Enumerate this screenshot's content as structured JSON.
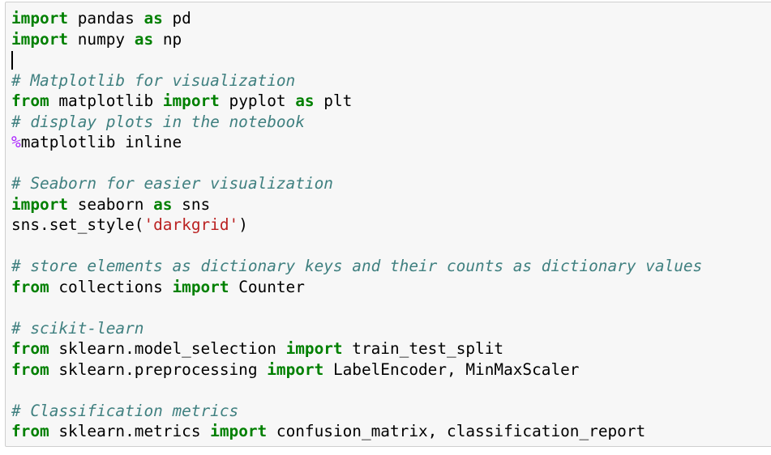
{
  "colors": {
    "keyword": "#008000",
    "comment": "#408080",
    "string": "#ba2121",
    "magic": "#aa22ff",
    "text": "#000000",
    "cell_background": "#f7f7f7",
    "cell_border": "#cfcfcf"
  },
  "code_cell": {
    "lines": [
      [
        {
          "t": "kw",
          "v": "import"
        },
        {
          "t": "tx",
          "v": " pandas "
        },
        {
          "t": "kw",
          "v": "as"
        },
        {
          "t": "tx",
          "v": " pd"
        }
      ],
      [
        {
          "t": "kw",
          "v": "import"
        },
        {
          "t": "tx",
          "v": " numpy "
        },
        {
          "t": "kw",
          "v": "as"
        },
        {
          "t": "tx",
          "v": " np"
        }
      ],
      [
        {
          "t": "cursor",
          "v": ""
        }
      ],
      [
        {
          "t": "cm",
          "v": "# Matplotlib for visualization"
        }
      ],
      [
        {
          "t": "kw",
          "v": "from"
        },
        {
          "t": "tx",
          "v": " matplotlib "
        },
        {
          "t": "kw",
          "v": "import"
        },
        {
          "t": "tx",
          "v": " pyplot "
        },
        {
          "t": "kw",
          "v": "as"
        },
        {
          "t": "tx",
          "v": " plt"
        }
      ],
      [
        {
          "t": "cm",
          "v": "# display plots in the notebook"
        }
      ],
      [
        {
          "t": "mg",
          "v": "%"
        },
        {
          "t": "tx",
          "v": "matplotlib inline"
        }
      ],
      [],
      [
        {
          "t": "cm",
          "v": "# Seaborn for easier visualization"
        }
      ],
      [
        {
          "t": "kw",
          "v": "import"
        },
        {
          "t": "tx",
          "v": " seaborn "
        },
        {
          "t": "kw",
          "v": "as"
        },
        {
          "t": "tx",
          "v": " sns"
        }
      ],
      [
        {
          "t": "tx",
          "v": "sns.set_style("
        },
        {
          "t": "st",
          "v": "'darkgrid'"
        },
        {
          "t": "tx",
          "v": ")"
        }
      ],
      [],
      [
        {
          "t": "cm",
          "v": "# store elements as dictionary keys and their counts as dictionary values"
        }
      ],
      [
        {
          "t": "kw",
          "v": "from"
        },
        {
          "t": "tx",
          "v": " collections "
        },
        {
          "t": "kw",
          "v": "import"
        },
        {
          "t": "tx",
          "v": " Counter"
        }
      ],
      [],
      [
        {
          "t": "cm",
          "v": "# scikit-learn"
        }
      ],
      [
        {
          "t": "kw",
          "v": "from"
        },
        {
          "t": "tx",
          "v": " sklearn.model_selection "
        },
        {
          "t": "kw",
          "v": "import"
        },
        {
          "t": "tx",
          "v": " train_test_split"
        }
      ],
      [
        {
          "t": "kw",
          "v": "from"
        },
        {
          "t": "tx",
          "v": " sklearn.preprocessing "
        },
        {
          "t": "kw",
          "v": "import"
        },
        {
          "t": "tx",
          "v": " LabelEncoder, MinMaxScaler"
        }
      ],
      [],
      [
        {
          "t": "cm",
          "v": "# Classification metrics"
        }
      ],
      [
        {
          "t": "kw",
          "v": "from"
        },
        {
          "t": "tx",
          "v": " sklearn.metrics "
        },
        {
          "t": "kw",
          "v": "import"
        },
        {
          "t": "tx",
          "v": " confusion_matrix, classification_report"
        }
      ]
    ]
  }
}
